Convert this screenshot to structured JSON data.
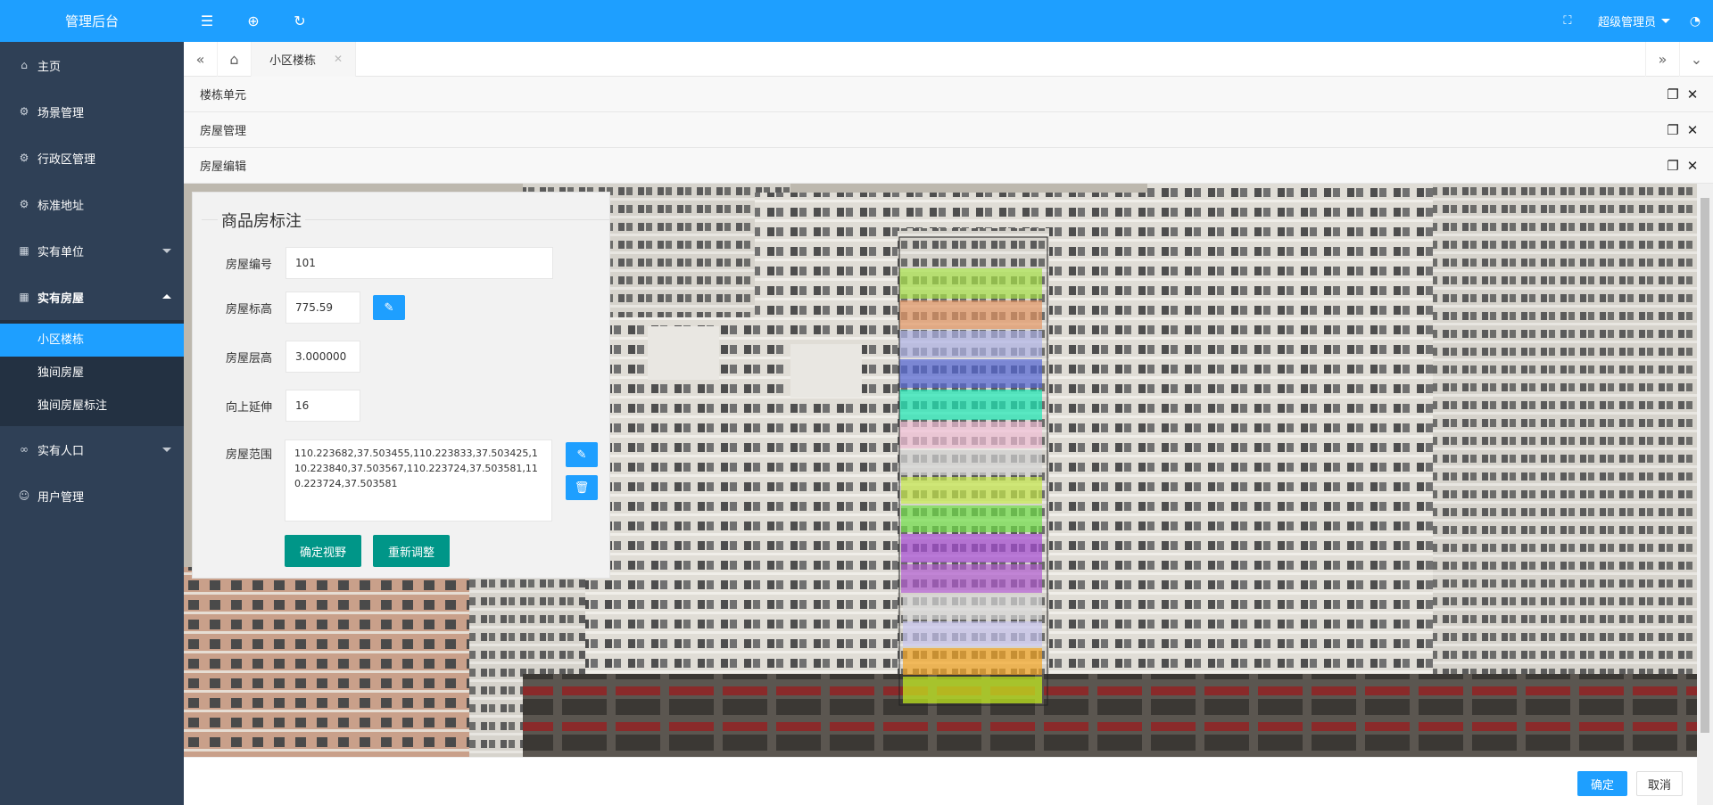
{
  "app": {
    "title": "管理后台"
  },
  "sidebar": {
    "items": [
      {
        "label": "主页",
        "icon": "home-icon"
      },
      {
        "label": "场景管理",
        "icon": "gear-icon"
      },
      {
        "label": "行政区管理",
        "icon": "gear-icon"
      },
      {
        "label": "标准地址",
        "icon": "gear-icon"
      },
      {
        "label": "实有单位",
        "icon": "grid-icon"
      },
      {
        "label": "实有房屋",
        "icon": "grid-icon"
      },
      {
        "label": "实有人口",
        "icon": "link-icon"
      },
      {
        "label": "用户管理",
        "icon": "user-icon"
      }
    ],
    "sub_items": [
      {
        "label": "小区楼栋",
        "active": true
      },
      {
        "label": "独间房屋"
      },
      {
        "label": "独间房屋标注"
      }
    ]
  },
  "topbar": {
    "user": "超级管理员"
  },
  "tabs": {
    "active": "小区楼栋"
  },
  "layers": [
    "楼栋单元",
    "房屋管理",
    "房屋编辑"
  ],
  "form": {
    "title": "商品房标注",
    "fields": {
      "room_no": {
        "label": "房屋编号",
        "value": "101"
      },
      "elevation": {
        "label": "房屋标高",
        "value": "775.59"
      },
      "floor_height": {
        "label": "房屋层高",
        "value": "3.000000"
      },
      "extend_up": {
        "label": "向上延伸",
        "value": "16"
      },
      "range": {
        "label": "房屋范围",
        "value": "110.223682,37.503455,110.223833,37.503425,110.223840,37.503567,110.223724,37.503581,110.223724,37.503581"
      }
    },
    "confirm_view": "确定视野",
    "readjust": "重新调整"
  },
  "footer": {
    "ok": "确定",
    "cancel": "取消"
  },
  "colors": {
    "primary": "#1e9fff",
    "sidebar": "#2f4056",
    "teal": "#009688"
  }
}
